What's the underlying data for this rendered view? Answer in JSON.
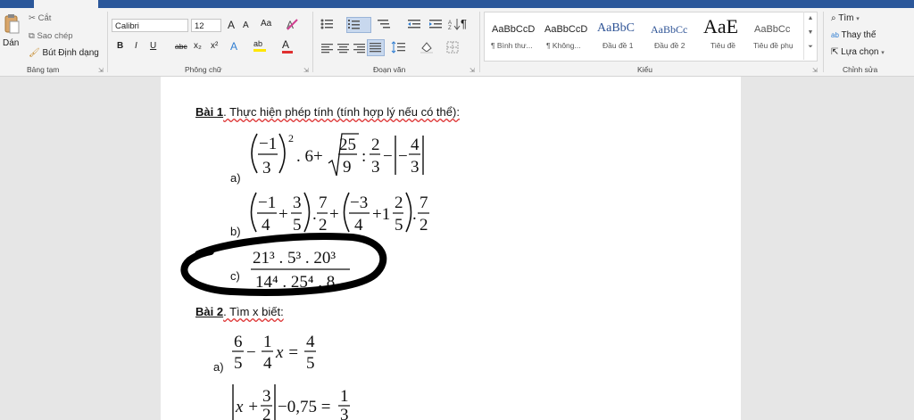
{
  "ribbon": {
    "clipboard": {
      "paste": "Dán",
      "cut": "Cắt",
      "copy": "Sao chép",
      "format_painter": "Bút Định dạng",
      "label": "Bảng tạm"
    },
    "font": {
      "name": "Calibri",
      "size": "12",
      "grow": "A",
      "shrink": "A",
      "case": "Aa",
      "bold": "B",
      "italic": "I",
      "underline": "U",
      "strike": "abc",
      "subscript": "x₂",
      "superscript": "x²",
      "text_effects": "A",
      "highlight": "ab",
      "font_color": "A",
      "label": "Phông chữ"
    },
    "paragraph": {
      "pilcrow": "¶",
      "label": "Đoạn văn"
    },
    "styles": {
      "items": [
        {
          "preview": "AaBbCcD",
          "name": "¶ Bình thư..."
        },
        {
          "preview": "AaBbCcD",
          "name": "¶ Không..."
        },
        {
          "preview": "AaBbC",
          "name": "Đầu đề 1"
        },
        {
          "preview": "AaBbCc",
          "name": "Đầu đề 2"
        },
        {
          "preview": "AaE",
          "name": "Tiêu đề"
        },
        {
          "preview": "AaBbCc",
          "name": "Tiêu đề phụ"
        }
      ],
      "label": "Kiểu"
    },
    "editing": {
      "find": "Tìm",
      "replace": "Thay thế",
      "select": "Lựa chọn",
      "label": "Chỉnh sửa"
    },
    "colors": {
      "accent": "#2b579a",
      "ribbon": "#f3f3f3",
      "font_red": "#e03030",
      "highlight_yellow": "#ffe600"
    }
  },
  "document": {
    "bai1": {
      "title": "Bài 1",
      "text": ". Thực hiện phép tính (tính hợp lý nếu có thể):"
    },
    "items": {
      "a": "a)",
      "b": "b)",
      "c": "c)"
    },
    "bai2": {
      "title": "Bài 2",
      "text": ". Tìm x biết:"
    },
    "bai2_items": {
      "a": "a)"
    },
    "math": {
      "a_n1": "−1",
      "a_d1": "3",
      "a_exp": "2",
      "a_mul6": ". 6+",
      "a_rn": "25",
      "a_rd": "9",
      "a_colon": ":",
      "a_n2": "2",
      "a_d2": "3",
      "a_minus": "−",
      "a_n3": "4",
      "a_d3": "3",
      "a_neg": "−",
      "b_n1": "−1",
      "b_d1": "4",
      "b_plus1": "+",
      "b_n2": "3",
      "b_d2": "5",
      "b_dot1": ".",
      "b_n3": "7",
      "b_d3": "2",
      "b_plus2": "+",
      "b_n4": "−3",
      "b_d4": "4",
      "b_plus3": "+1",
      "b_n5": "2",
      "b_d5": "5",
      "b_dot2": ".",
      "b_n6": "7",
      "b_d6": "2",
      "c_num": "21³ . 5³ . 20³",
      "c_den": "14⁴ . 25⁴ . 8",
      "x1_n1": "6",
      "x1_d1": "5",
      "x1_minus": "−",
      "x1_n2": "1",
      "x1_d2": "4",
      "x1_x": "x =",
      "x1_n3": "4",
      "x1_d3": "5",
      "x2_x": "x +",
      "x2_n1": "3",
      "x2_d1": "2",
      "x2_rest": "−0,75 =",
      "x2_n2": "1",
      "x2_d2": "3"
    }
  }
}
